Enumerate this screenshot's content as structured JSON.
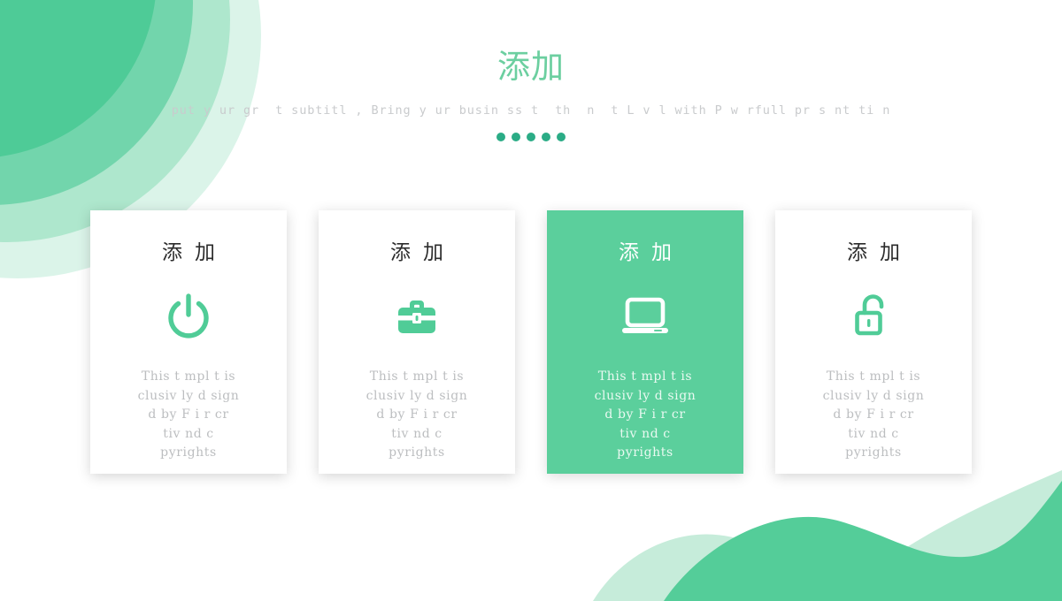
{
  "theme": {
    "accent": "#5bcf9c",
    "title_color": "#6ccfa0",
    "dot_color": "#2bac86",
    "subtitle_color": "#c9cbcd",
    "card_bg": "#ffffff",
    "card_text": "#bcbec0"
  },
  "header": {
    "title": "添加",
    "subtitle": "put y ur gr  t subtitl , Bring y ur busin ss t  th  n  t L v l with P w rfull pr s nt ti n",
    "dots": [
      1,
      2,
      3,
      4,
      5
    ]
  },
  "cards": [
    {
      "title": "添加",
      "icon": "power-icon",
      "body": "This t mpl t  is\n clusiv ly d sign\nd by F i  r cr\ntiv   nd c\npyrights",
      "active": false
    },
    {
      "title": "添加",
      "icon": "briefcase-icon",
      "body": "This t mpl t  is\n clusiv ly d sign\nd by F i  r cr\ntiv   nd c\npyrights",
      "active": false
    },
    {
      "title": "添加",
      "icon": "laptop-icon",
      "body": "This t mpl t  is\n clusiv ly d sign\nd by F i  r cr\ntiv   nd c\npyrights",
      "active": true
    },
    {
      "title": "添加",
      "icon": "unlock-icon",
      "body": "This t mpl t  is\n clusiv ly d sign\nd by F i  r cr\ntiv   nd c\npyrights",
      "active": false
    }
  ]
}
